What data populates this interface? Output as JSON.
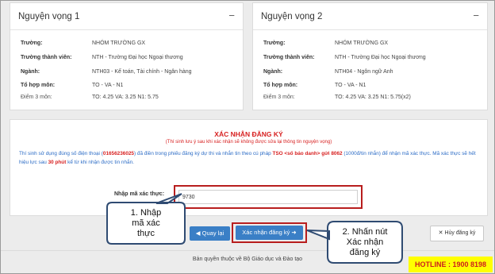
{
  "wish1": {
    "title": "Nguyện vọng 1",
    "collapse": "−",
    "rows": [
      {
        "label": "Trường:",
        "value": "NHÓM TRƯỜNG GX"
      },
      {
        "label": "Trường thành viên:",
        "value": "NTH - Trường Đại học Ngoại thương"
      },
      {
        "label": "Ngành:",
        "value": "NTH03 - Kế toán, Tài chính - Ngân hàng"
      },
      {
        "label": "Tổ hợp môn:",
        "value": "TO - VA - N1"
      },
      {
        "label": "Điểm 3 môn:",
        "value": "TO: 4.25 VA: 3.25 N1: 5.75"
      }
    ]
  },
  "wish2": {
    "title": "Nguyện vọng 2",
    "collapse": "−",
    "rows": [
      {
        "label": "Trường:",
        "value": "NHÓM TRƯỜNG GX"
      },
      {
        "label": "Trường thành viên:",
        "value": "NTH - Trường Đại học Ngoại thương"
      },
      {
        "label": "Ngành:",
        "value": "NTH04 - Ngôn ngữ Anh"
      },
      {
        "label": "Tổ hợp môn:",
        "value": "TO - VA - N1"
      },
      {
        "label": "Điểm 3 môn:",
        "value": "TO: 4.25 VA: 3.25 N1: 5.75(x2)"
      }
    ]
  },
  "confirm": {
    "title": "XÁC NHẬN ĐĂNG KÝ",
    "subtitle": "(Thí sinh lưu ý sau khi xác nhận sẽ không được sửa lại thông tin nguyện vọng)",
    "desc1": "Thí sinh sử dụng đúng số điện thoại (",
    "phone": "01656236025",
    "desc2": ") đã điền trong phiếu đăng ký dự thi và nhắn tin theo cú pháp ",
    "syntax": "TSO <số báo danh> gửi 8062",
    "desc3": " (1000đ/tin nhắn) để nhận mã xác thực. Mã xác thực sẽ hết hiệu lực sau ",
    "expiry": "30 phút",
    "desc4": " kể từ khi nhận được tin nhắn.",
    "code_label": "Nhập mã xác thực:",
    "code_value": "9730",
    "back_label": "Quay lại",
    "confirm_label": "Xác nhận đăng ký",
    "cancel_label": "Hủy đăng ký"
  },
  "footer": {
    "copyright": "Bản quyền thuộc về Bộ Giáo dục và Đào tạo",
    "hotline": "HOTLINE : 1900 8198"
  },
  "callouts": {
    "step1": [
      "1. Nhập",
      "mã xác",
      "thực"
    ],
    "step2": [
      "2. Nhấn nút",
      "Xác nhận",
      "đăng ký"
    ]
  },
  "icons": {
    "back": "arrow-left-icon",
    "confirm": "arrow-right-icon",
    "cancel": "close-icon"
  }
}
